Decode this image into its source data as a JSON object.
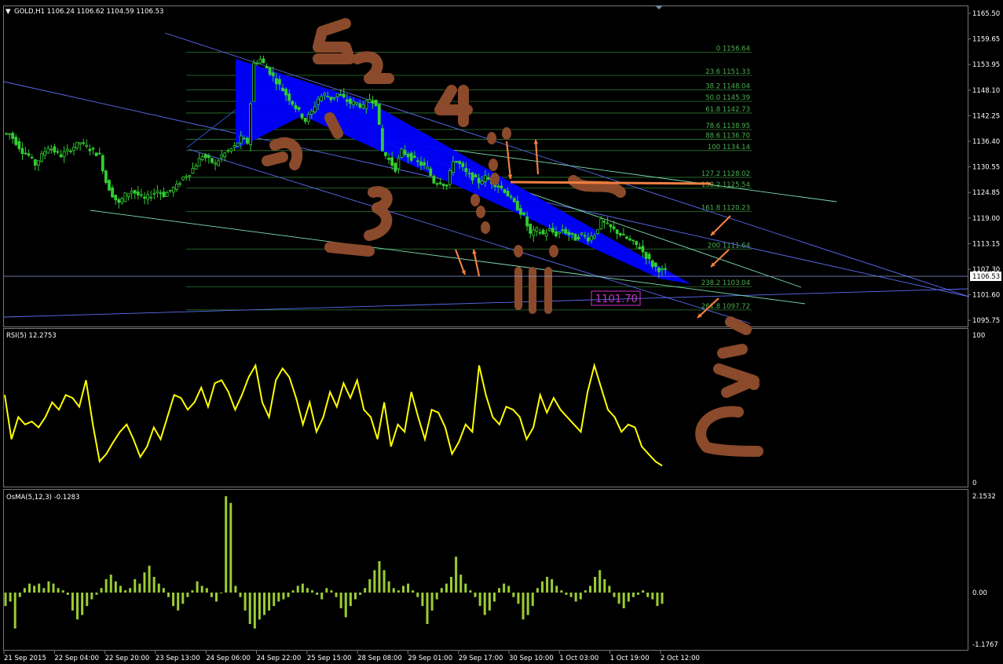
{
  "window": {
    "main_title": "GOLD,H1  1106.24 1106.62 1104.59 1106.53",
    "rsi_title": "RSI(5) 12.2753",
    "osma_title": "OsMA(5,12,3) -0.1283"
  },
  "price_axis": {
    "labels": [
      "1165.50",
      "1159.65",
      "1153.95",
      "1148.10",
      "1142.25",
      "1136.40",
      "1130.55",
      "1124.85",
      "1119.00",
      "1113.15",
      "1107.30",
      "1101.60",
      "1095.75"
    ],
    "current_price": "1106.53",
    "marked_price": "1101.70"
  },
  "rsi_axis": {
    "top": "100",
    "bottom": "0"
  },
  "osma_axis": {
    "top": "2.1532",
    "zero": "0.00",
    "bottom": "-1.1767"
  },
  "time_axis": [
    "21 Sep 2015",
    "22 Sep 04:00",
    "22 Sep 20:00",
    "23 Sep 13:00",
    "24 Sep 06:00",
    "24 Sep 22:00",
    "25 Sep 15:00",
    "28 Sep 08:00",
    "29 Sep 01:00",
    "29 Sep 17:00",
    "30 Sep 10:00",
    "1 Oct 03:00",
    "1 Oct 19:00",
    "2 Oct 12:00"
  ],
  "fib_levels": [
    {
      "label": "0 1156.64"
    },
    {
      "label": "23.6 1151.33"
    },
    {
      "label": "38.2 1148.04"
    },
    {
      "label": "50.0 1145.39"
    },
    {
      "label": "61.8 1142.73"
    },
    {
      "label": "78.6 1138.95"
    },
    {
      "label": "88.6 1136.70"
    },
    {
      "label": "100 1134.14"
    },
    {
      "label": "127.2 1128.02"
    },
    {
      "label": "138.2 1125.54"
    },
    {
      "label": "161.8 1120.23"
    },
    {
      "label": "200 1111.64"
    },
    {
      "label": "238.2 1103.04"
    },
    {
      "label": "261.8 1097.72"
    }
  ],
  "colors": {
    "candle": "#32cd32",
    "fib_line": "#2e7d32",
    "channel": "#5b6cf0",
    "rsi": "#ffff00",
    "osma": "#9acd32",
    "wedge": "#0000ff",
    "annotation": "#8b4a2b",
    "arrow": "#f08040",
    "marked_price_box": "#cc33cc"
  },
  "chart_data": [
    {
      "type": "candlestick",
      "symbol": "GOLD",
      "timeframe": "H1",
      "ylim": [
        1093,
        1168
      ],
      "close_path": [
        1138,
        1136,
        1134,
        1133,
        1131,
        1133,
        1135,
        1134,
        1133,
        1134,
        1135,
        1136,
        1135,
        1134,
        1133,
        1127,
        1124,
        1122,
        1124,
        1125,
        1124,
        1123,
        1124,
        1125,
        1124,
        1125,
        1126,
        1128,
        1129,
        1131,
        1133,
        1132,
        1131,
        1133,
        1134,
        1135,
        1137,
        1136,
        1154,
        1155,
        1153,
        1151,
        1149,
        1147,
        1145,
        1143,
        1141,
        1143,
        1146,
        1147,
        1146,
        1147,
        1146,
        1145,
        1145,
        1144,
        1146,
        1145,
        1134,
        1132,
        1130,
        1134,
        1133,
        1132,
        1131,
        1130,
        1127,
        1127,
        1126,
        1132,
        1131,
        1129,
        1128,
        1127,
        1128,
        1127,
        1126,
        1125,
        1123,
        1121,
        1119,
        1115,
        1116,
        1115,
        1116,
        1115,
        1116,
        1115,
        1114,
        1115,
        1114,
        1115,
        1118,
        1117,
        1116,
        1115,
        1114,
        1113,
        1112,
        1110,
        1108,
        1107,
        1106.5
      ],
      "current_price": 1106.53
    },
    {
      "type": "line",
      "name": "RSI(5)",
      "ylim": [
        0,
        100
      ],
      "last_value": 12.2753,
      "values": [
        60,
        30,
        45,
        40,
        42,
        38,
        45,
        55,
        50,
        60,
        58,
        52,
        70,
        40,
        15,
        20,
        28,
        35,
        40,
        30,
        18,
        25,
        38,
        30,
        45,
        60,
        58,
        50,
        55,
        65,
        52,
        68,
        70,
        62,
        50,
        60,
        72,
        80,
        55,
        45,
        70,
        78,
        72,
        58,
        40,
        55,
        35,
        45,
        62,
        52,
        68,
        58,
        70,
        50,
        45,
        30,
        55,
        25,
        40,
        35,
        62,
        45,
        30,
        50,
        48,
        38,
        20,
        28,
        40,
        35,
        80,
        60,
        45,
        40,
        52,
        50,
        45,
        30,
        38,
        60,
        48,
        58,
        50,
        45,
        40,
        35,
        62,
        80,
        65,
        50,
        45,
        35,
        40,
        38,
        25,
        20,
        15,
        12
      ]
    },
    {
      "type": "bar",
      "name": "OsMA(5,12,3)",
      "ylim": [
        -1.1767,
        2.1532
      ],
      "last_value": -0.1283,
      "values": [
        -0.3,
        -0.2,
        -0.8,
        -0.1,
        0.1,
        0.2,
        0.15,
        0.2,
        0.1,
        0.25,
        0.2,
        0.1,
        0.05,
        -0.05,
        -0.4,
        -0.6,
        -0.5,
        -0.3,
        -0.15,
        -0.05,
        0.1,
        0.3,
        0.4,
        0.25,
        0.15,
        0.05,
        0.1,
        0.3,
        0.2,
        0.45,
        0.6,
        0.35,
        0.2,
        0.1,
        -0.1,
        -0.3,
        -0.4,
        -0.25,
        -0.1,
        0.05,
        0.25,
        0.15,
        0.1,
        -0.1,
        -0.2,
        0.0,
        2.15,
        2.0,
        0.15,
        -0.1,
        -0.4,
        -0.7,
        -0.8,
        -0.6,
        -0.5,
        -0.4,
        -0.3,
        -0.2,
        -0.15,
        -0.1,
        0.05,
        0.15,
        0.2,
        0.1,
        0.05,
        -0.05,
        -0.15,
        0.1,
        0.05,
        -0.1,
        -0.35,
        -0.55,
        -0.3,
        -0.15,
        -0.05,
        0.1,
        0.3,
        0.5,
        0.7,
        0.5,
        0.25,
        0.1,
        0.05,
        0.15,
        0.2,
        0.05,
        -0.1,
        -0.3,
        -0.7,
        -0.4,
        -0.15,
        0.1,
        0.2,
        0.35,
        0.8,
        0.4,
        0.2,
        0.05,
        -0.1,
        -0.3,
        -0.5,
        -0.4,
        -0.2,
        0.1,
        0.2,
        0.15,
        -0.1,
        -0.25,
        -0.6,
        -0.5,
        -0.3,
        0.1,
        0.25,
        0.35,
        0.3,
        0.15,
        0.05,
        -0.05,
        -0.1,
        -0.2,
        -0.15,
        0.05,
        0.15,
        0.35,
        0.5,
        0.3,
        0.15,
        -0.1,
        -0.25,
        -0.35,
        -0.2,
        -0.1,
        -0.05,
        0.05,
        -0.1,
        -0.15,
        -0.3,
        -0.25
      ]
    }
  ]
}
